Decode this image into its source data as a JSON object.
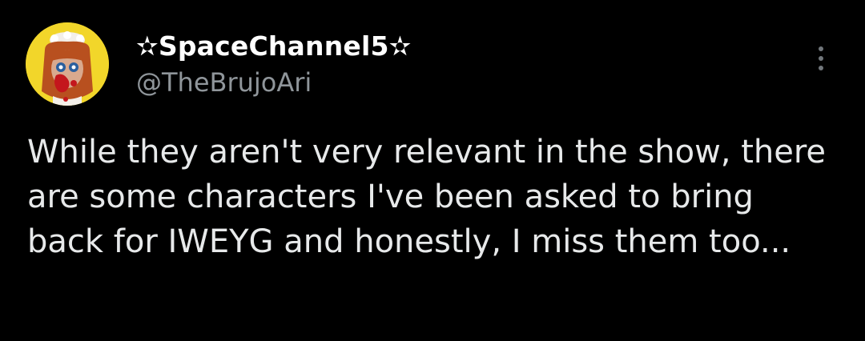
{
  "tweet": {
    "author": {
      "display_name": "✫SpaceChannel5✫",
      "handle": "@TheBrujoAri",
      "avatar_icon": "doll-avatar-icon",
      "avatar_bg": "#f2d62a"
    },
    "more_icon": "more-options-icon",
    "text": "While they aren't very relevant in the show, there are some characters I've been asked to bring back for IWEYG and honestly, I miss them too..."
  },
  "colors": {
    "background": "#000000",
    "name": "#ffffff",
    "handle": "#8f959a",
    "text": "#e7e9ea"
  }
}
